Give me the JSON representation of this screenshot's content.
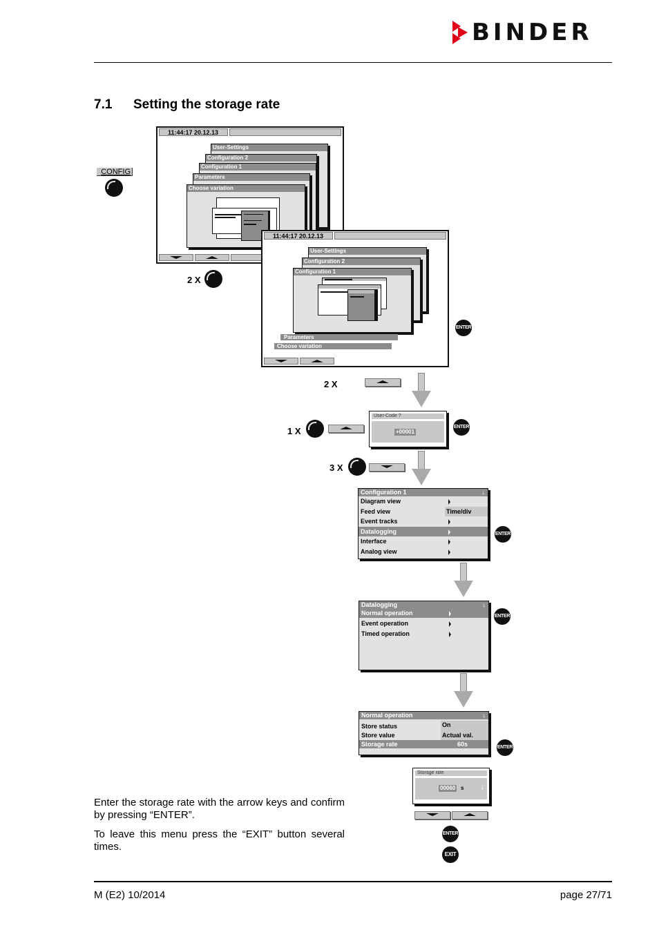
{
  "header": {
    "brand": "BINDER",
    "brand_color": "#e3001b"
  },
  "section": {
    "number": "7.1",
    "title": "Setting the storage rate"
  },
  "steps": {
    "config_button": "CONFIG",
    "repeat_2x": "2 X",
    "repeat_2x_b": "2 X",
    "repeat_1x": "1 X",
    "repeat_3x": "3 X",
    "enter_label": "ENTER",
    "exit_label": "EXIT"
  },
  "screen1": {
    "time": "11:44:17  20.12.13",
    "windows": [
      "User-Settings",
      "Configuration 2",
      "Configuration 1",
      "Parameters",
      "Choose variation"
    ]
  },
  "screen2": {
    "time": "11:44:17  20.12.13",
    "windows": [
      "User-Settings",
      "Configuration 2",
      "Configuration 1"
    ],
    "bars": [
      "Parameters",
      "Choose variation"
    ]
  },
  "user_code_dialog": {
    "title": "User-Code ?",
    "value": "+00001"
  },
  "config1_menu": {
    "title": "Configuration 1",
    "items": [
      {
        "label": "Diagram view",
        "value": ""
      },
      {
        "label": "Feed view",
        "value": "Time/div"
      },
      {
        "label": "Event tracks",
        "value": ""
      },
      {
        "label": "Datalogging",
        "value": "",
        "selected": true
      },
      {
        "label": "Interface",
        "value": ""
      },
      {
        "label": "Analog view",
        "value": ""
      }
    ]
  },
  "datalogging_menu": {
    "title": "Datalogging",
    "items": [
      {
        "label": "Normal operation",
        "selected": true
      },
      {
        "label": "Event operation"
      },
      {
        "label": "Timed operation"
      }
    ]
  },
  "normal_op_menu": {
    "title": "Normal operation",
    "items": [
      {
        "label": "Store status",
        "value": "On"
      },
      {
        "label": "Store value",
        "value": "Actual val."
      },
      {
        "label": "Storage rate",
        "value": "60s",
        "selected": true
      }
    ]
  },
  "storage_rate_dialog": {
    "title": "Storage rate",
    "value": "00060",
    "unit": "s"
  },
  "instructions": {
    "p1": "Enter the storage rate with the arrow keys and confirm by pressing “ENTER”.",
    "p2": "To leave this menu press the “EXIT” button several times."
  },
  "footer": {
    "doc_ref": "M (E2) 10/2014",
    "page": "page 27/71"
  }
}
